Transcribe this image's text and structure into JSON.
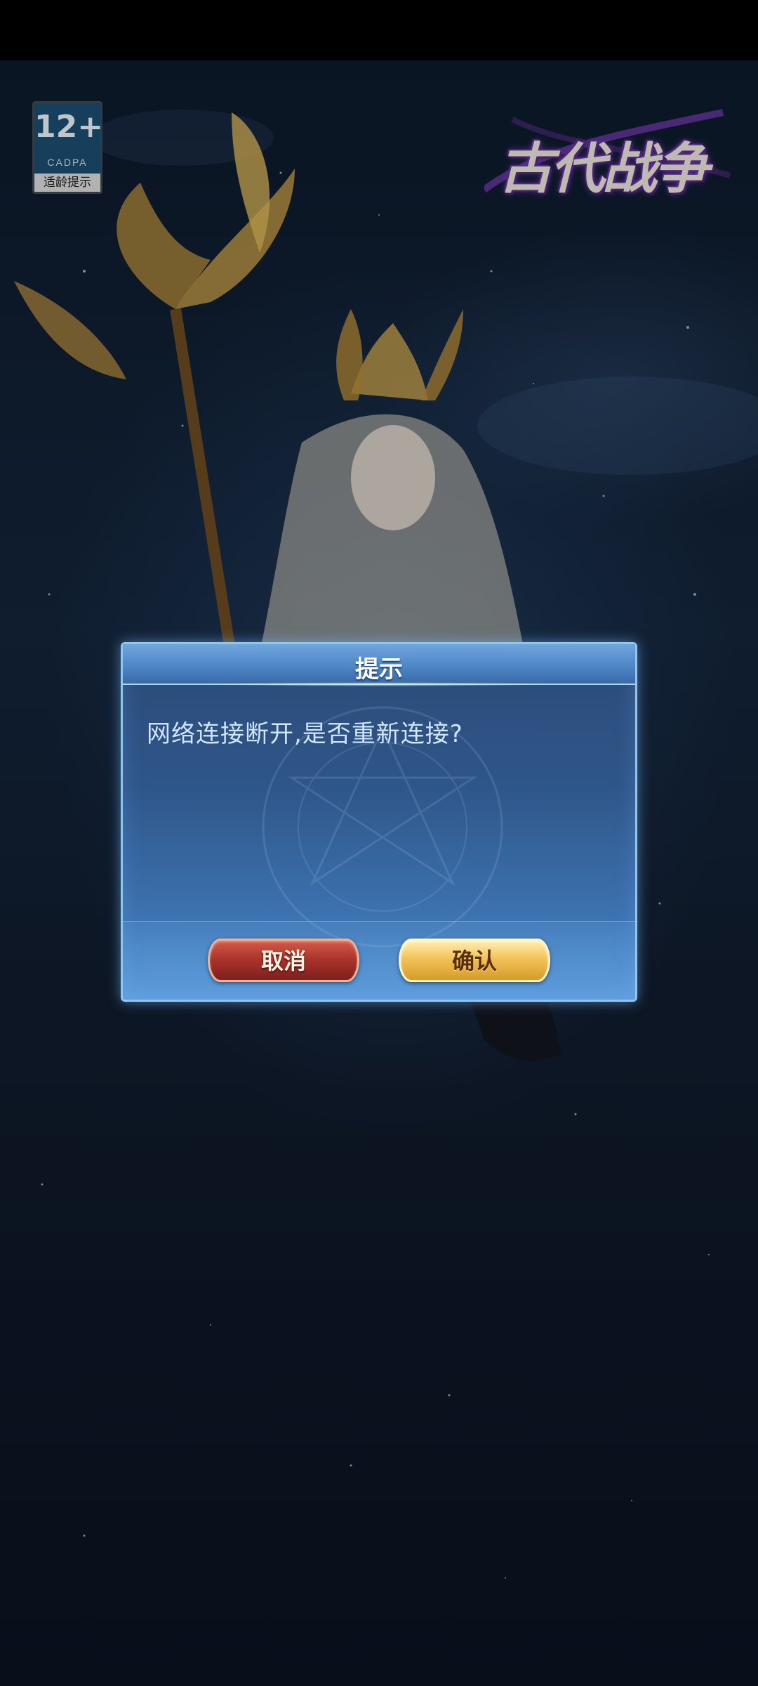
{
  "rating_badge": {
    "age": "12+",
    "org": "CADPA",
    "note": "适龄提示"
  },
  "game_logo": {
    "title": "古代战争"
  },
  "dialog": {
    "title": "提示",
    "message": "网络连接断开,是否重新连接?",
    "cancel_label": "取消",
    "confirm_label": "确认"
  },
  "colors": {
    "dialog_body": "#2f5689",
    "dialog_border": "#8fc6ee",
    "cancel_button": "#a8322a",
    "confirm_button": "#f2c35a"
  }
}
